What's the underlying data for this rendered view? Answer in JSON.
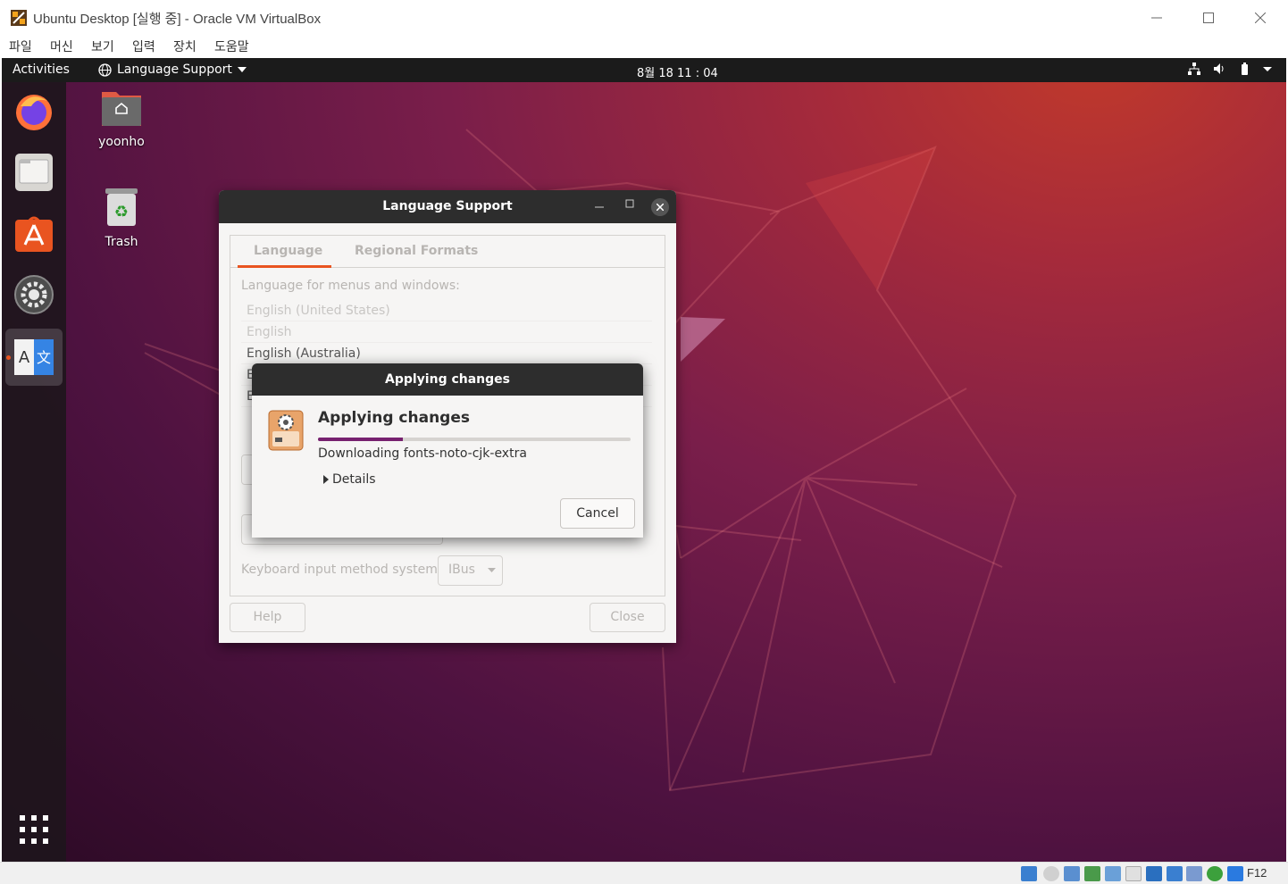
{
  "host": {
    "title": "Ubuntu Desktop [실행 중] - Oracle VM VirtualBox",
    "menu": [
      "파일",
      "머신",
      "보기",
      "입력",
      "장치",
      "도움말"
    ],
    "status_key": "F12"
  },
  "guest": {
    "topbar": {
      "activities": "Activities",
      "app_menu": "Language Support",
      "clock": "8월 18  11 : 04"
    },
    "desktop_icons": [
      {
        "label": "yoonho",
        "icon": "home-folder-icon"
      },
      {
        "label": "Trash",
        "icon": "trash-icon"
      }
    ],
    "dock": [
      "firefox-icon",
      "files-icon",
      "software-icon",
      "settings-icon",
      "language-support-icon",
      "show-apps-icon"
    ]
  },
  "language_support": {
    "title": "Language Support",
    "tabs": [
      "Language",
      "Regional Formats"
    ],
    "menus_label": "Language for menus and windows:",
    "languages": [
      "English (United States)",
      "English",
      "English (Australia)",
      "E",
      "E"
    ],
    "keyboard_label": "Keyboard input method system:",
    "keyboard_value": "IBus",
    "help": "Help",
    "close": "Close"
  },
  "applying": {
    "window_title": "Applying changes",
    "heading": "Applying changes",
    "progress": 0.27,
    "status": "Downloading fonts-noto-cjk-extra",
    "details": "Details",
    "cancel": "Cancel"
  }
}
